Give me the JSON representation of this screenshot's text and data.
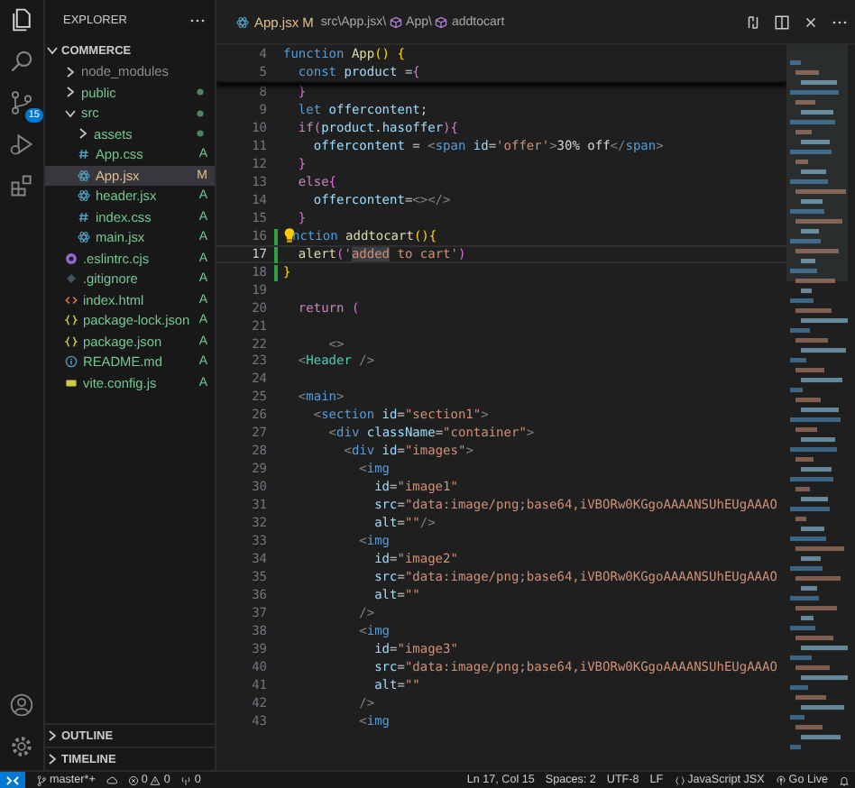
{
  "activity_bar": {
    "source_control_badge": "15"
  },
  "sidebar": {
    "title": "EXPLORER",
    "workspace": {
      "label": "COMMERCE",
      "expanded": true
    },
    "tree": [
      {
        "kind": "folder",
        "name": "node_modules",
        "expanded": false,
        "dot": false,
        "selected": false,
        "color": "#8c8c8c"
      },
      {
        "kind": "folder",
        "name": "public",
        "expanded": false,
        "dot": true,
        "selected": false,
        "color": "#73c991"
      },
      {
        "kind": "folder",
        "name": "src",
        "expanded": true,
        "dot": true,
        "selected": false,
        "color": "#73c991",
        "children": [
          {
            "kind": "folder",
            "name": "assets",
            "expanded": false,
            "dot": true,
            "selected": false,
            "color": "#73c991"
          },
          {
            "kind": "css",
            "name": "App.css",
            "status": "A",
            "selected": false,
            "color": "#73c991"
          },
          {
            "kind": "react",
            "name": "App.jsx",
            "status": "M",
            "selected": true,
            "color": "#e2c08d"
          },
          {
            "kind": "react",
            "name": "header.jsx",
            "status": "A",
            "selected": false,
            "color": "#73c991"
          },
          {
            "kind": "css",
            "name": "index.css",
            "status": "A",
            "selected": false,
            "color": "#73c991"
          },
          {
            "kind": "react",
            "name": "main.jsx",
            "status": "A",
            "selected": false,
            "color": "#73c991"
          }
        ]
      },
      {
        "kind": "eslint",
        "name": ".eslintrc.cjs",
        "status": "A",
        "selected": false,
        "color": "#73c991"
      },
      {
        "kind": "git",
        "name": ".gitignore",
        "status": "A",
        "selected": false,
        "color": "#73c991"
      },
      {
        "kind": "html",
        "name": "index.html",
        "status": "A",
        "selected": false,
        "color": "#73c991"
      },
      {
        "kind": "json",
        "name": "package-lock.json",
        "status": "A",
        "selected": false,
        "color": "#73c991"
      },
      {
        "kind": "json",
        "name": "package.json",
        "status": "A",
        "selected": false,
        "color": "#73c991"
      },
      {
        "kind": "info",
        "name": "README.md",
        "status": "A",
        "selected": false,
        "color": "#73c991"
      },
      {
        "kind": "js",
        "name": "vite.config.js",
        "status": "A",
        "selected": false,
        "color": "#73c991"
      }
    ],
    "panels": [
      {
        "label": "OUTLINE",
        "expanded": false
      },
      {
        "label": "TIMELINE",
        "expanded": false
      }
    ]
  },
  "editor": {
    "tab": {
      "label": "App.jsx",
      "status": "M"
    },
    "breadcrumbs": [
      {
        "kind": "path",
        "label": "src\\App.jsx\\"
      },
      {
        "kind": "symbol",
        "label": "App\\"
      },
      {
        "kind": "symbol",
        "label": "addtocart"
      }
    ],
    "sticky_lines": [
      {
        "n": "4",
        "tokens": [
          {
            "text": "function ",
            "kind": "kw"
          },
          {
            "text": "App",
            "kind": "fn"
          },
          {
            "text": "() {",
            "kind": "b1"
          }
        ]
      },
      {
        "n": "5",
        "tokens": [
          {
            "text": "  const ",
            "kind": "kw"
          },
          {
            "text": "product",
            "kind": "var"
          },
          {
            "text": " =",
            "kind": "p"
          },
          {
            "text": "{",
            "kind": "b2"
          }
        ]
      }
    ],
    "lines": [
      {
        "n": "8",
        "current": false,
        "added": false,
        "tokens": [
          {
            "text": "  }",
            "kind": "b2"
          }
        ]
      },
      {
        "n": "9",
        "current": false,
        "added": false,
        "tokens": [
          {
            "text": "  let ",
            "kind": "kw"
          },
          {
            "text": "offercontent",
            "kind": "var"
          },
          {
            "text": ";",
            "kind": "p"
          }
        ]
      },
      {
        "n": "10",
        "current": false,
        "added": false,
        "tokens": [
          {
            "text": "  if",
            "kind": "ctl"
          },
          {
            "text": "(",
            "kind": "b2"
          },
          {
            "text": "product",
            "kind": "var"
          },
          {
            "text": ".",
            "kind": "p"
          },
          {
            "text": "hasoffer",
            "kind": "var"
          },
          {
            "text": "){",
            "kind": "b2"
          }
        ]
      },
      {
        "n": "11",
        "current": false,
        "added": false,
        "tokens": [
          {
            "text": "    offercontent",
            "kind": "var"
          },
          {
            "text": " = ",
            "kind": "p"
          },
          {
            "text": "<",
            "kind": "tag-b"
          },
          {
            "text": "span",
            "kind": "tag"
          },
          {
            "text": " id",
            "kind": "attr"
          },
          {
            "text": "=",
            "kind": "p"
          },
          {
            "text": "'offer'",
            "kind": "str"
          },
          {
            "text": ">",
            "kind": "tag-b"
          },
          {
            "text": "30% off",
            "kind": "p"
          },
          {
            "text": "</",
            "kind": "tag-b"
          },
          {
            "text": "span",
            "kind": "tag"
          },
          {
            "text": ">",
            "kind": "tag-b"
          }
        ]
      },
      {
        "n": "12",
        "current": false,
        "added": false,
        "tokens": [
          {
            "text": "  }",
            "kind": "b2"
          }
        ]
      },
      {
        "n": "13",
        "current": false,
        "added": false,
        "tokens": [
          {
            "text": "  else",
            "kind": "ctl"
          },
          {
            "text": "{",
            "kind": "b2"
          }
        ]
      },
      {
        "n": "14",
        "current": false,
        "added": false,
        "tokens": [
          {
            "text": "    offercontent",
            "kind": "var"
          },
          {
            "text": "=",
            "kind": "p"
          },
          {
            "text": "<></>",
            "kind": "tag-b"
          }
        ]
      },
      {
        "n": "15",
        "current": false,
        "added": false,
        "tokens": [
          {
            "text": "  }",
            "kind": "b2"
          }
        ]
      },
      {
        "n": "16",
        "current": false,
        "added": true,
        "tokens": [
          {
            "kind": "bulb"
          },
          {
            "text": "nction ",
            "kind": "kw"
          },
          {
            "text": "addtocart",
            "kind": "fn"
          },
          {
            "text": "(){",
            "kind": "b1"
          }
        ]
      },
      {
        "n": "17",
        "current": true,
        "added": true,
        "tokens": [
          {
            "text": "  alert",
            "kind": "fn"
          },
          {
            "text": "(",
            "kind": "b2"
          },
          {
            "text": "'",
            "kind": "str"
          },
          {
            "text": "added",
            "kind": "str-hl"
          },
          {
            "text": " to cart'",
            "kind": "str"
          },
          {
            "text": ")",
            "kind": "b2"
          }
        ]
      },
      {
        "n": "18",
        "current": false,
        "added": true,
        "tokens": [
          {
            "text": "}",
            "kind": "b1"
          }
        ]
      },
      {
        "n": "19",
        "current": false,
        "added": false
      },
      {
        "n": "20",
        "current": false,
        "added": false,
        "tokens": [
          {
            "text": "  return ",
            "kind": "ctl"
          },
          {
            "text": "(",
            "kind": "b2"
          }
        ]
      },
      {
        "n": "21",
        "current": false,
        "added": false
      },
      {
        "n": "22",
        "current": false,
        "added": false,
        "tokens": [
          {
            "text": "      <>",
            "kind": "tag-b"
          }
        ]
      },
      {
        "n": "23",
        "current": false,
        "added": false,
        "tokens": [
          {
            "text": "  <",
            "kind": "tag-b"
          },
          {
            "text": "Header",
            "kind": "comp"
          },
          {
            "text": " />",
            "kind": "tag-b"
          }
        ]
      },
      {
        "n": "24",
        "current": false,
        "added": false
      },
      {
        "n": "25",
        "current": false,
        "added": false,
        "tokens": [
          {
            "text": "  <",
            "kind": "tag-b"
          },
          {
            "text": "main",
            "kind": "tag"
          },
          {
            "text": ">",
            "kind": "tag-b"
          }
        ]
      },
      {
        "n": "26",
        "current": false,
        "added": false,
        "tokens": [
          {
            "text": "    <",
            "kind": "tag-b"
          },
          {
            "text": "section",
            "kind": "tag"
          },
          {
            "text": " id",
            "kind": "attr"
          },
          {
            "text": "=",
            "kind": "p"
          },
          {
            "text": "\"section1\"",
            "kind": "str"
          },
          {
            "text": ">",
            "kind": "tag-b"
          }
        ]
      },
      {
        "n": "27",
        "current": false,
        "added": false,
        "tokens": [
          {
            "text": "      <",
            "kind": "tag-b"
          },
          {
            "text": "div",
            "kind": "tag"
          },
          {
            "text": " className",
            "kind": "attr"
          },
          {
            "text": "=",
            "kind": "p"
          },
          {
            "text": "\"container\"",
            "kind": "str"
          },
          {
            "text": ">",
            "kind": "tag-b"
          }
        ]
      },
      {
        "n": "28",
        "current": false,
        "added": false,
        "tokens": [
          {
            "text": "        <",
            "kind": "tag-b"
          },
          {
            "text": "div",
            "kind": "tag"
          },
          {
            "text": " id",
            "kind": "attr"
          },
          {
            "text": "=",
            "kind": "p"
          },
          {
            "text": "\"images\"",
            "kind": "str"
          },
          {
            "text": ">",
            "kind": "tag-b"
          }
        ]
      },
      {
        "n": "29",
        "current": false,
        "added": false,
        "tokens": [
          {
            "text": "          <",
            "kind": "tag-b"
          },
          {
            "text": "img",
            "kind": "tag"
          }
        ]
      },
      {
        "n": "30",
        "current": false,
        "added": false,
        "tokens": [
          {
            "text": "            id",
            "kind": "attr"
          },
          {
            "text": "=",
            "kind": "p"
          },
          {
            "text": "\"image1\"",
            "kind": "str"
          }
        ]
      },
      {
        "n": "31",
        "current": false,
        "added": false,
        "tokens": [
          {
            "text": "            src",
            "kind": "attr"
          },
          {
            "text": "=",
            "kind": "p"
          },
          {
            "text": "\"data:image/png;base64,iVBORw0KGgoAAAANSUhEUgAAAO",
            "kind": "str"
          }
        ]
      },
      {
        "n": "32",
        "current": false,
        "added": false,
        "tokens": [
          {
            "text": "            alt",
            "kind": "attr"
          },
          {
            "text": "=",
            "kind": "p"
          },
          {
            "text": "\"\"",
            "kind": "str"
          },
          {
            "text": "/>",
            "kind": "tag-b"
          }
        ]
      },
      {
        "n": "33",
        "current": false,
        "added": false,
        "tokens": [
          {
            "text": "          <",
            "kind": "tag-b"
          },
          {
            "text": "img",
            "kind": "tag"
          }
        ]
      },
      {
        "n": "34",
        "current": false,
        "added": false,
        "tokens": [
          {
            "text": "            id",
            "kind": "attr"
          },
          {
            "text": "=",
            "kind": "p"
          },
          {
            "text": "\"image2\"",
            "kind": "str"
          }
        ]
      },
      {
        "n": "35",
        "current": false,
        "added": false,
        "tokens": [
          {
            "text": "            src",
            "kind": "attr"
          },
          {
            "text": "=",
            "kind": "p"
          },
          {
            "text": "\"data:image/png;base64,iVBORw0KGgoAAAANSUhEUgAAAO",
            "kind": "str"
          }
        ]
      },
      {
        "n": "36",
        "current": false,
        "added": false,
        "tokens": [
          {
            "text": "            alt",
            "kind": "attr"
          },
          {
            "text": "=",
            "kind": "p"
          },
          {
            "text": "\"\"",
            "kind": "str"
          }
        ]
      },
      {
        "n": "37",
        "current": false,
        "added": false,
        "tokens": [
          {
            "text": "          />",
            "kind": "tag-b"
          }
        ]
      },
      {
        "n": "38",
        "current": false,
        "added": false,
        "tokens": [
          {
            "text": "          <",
            "kind": "tag-b"
          },
          {
            "text": "img",
            "kind": "tag"
          }
        ]
      },
      {
        "n": "39",
        "current": false,
        "added": false,
        "tokens": [
          {
            "text": "            id",
            "kind": "attr"
          },
          {
            "text": "=",
            "kind": "p"
          },
          {
            "text": "\"image3\"",
            "kind": "str"
          }
        ]
      },
      {
        "n": "40",
        "current": false,
        "added": false,
        "tokens": [
          {
            "text": "            src",
            "kind": "attr"
          },
          {
            "text": "=",
            "kind": "p"
          },
          {
            "text": "\"data:image/png;base64,iVBORw0KGgoAAAANSUhEUgAAAO",
            "kind": "str"
          }
        ]
      },
      {
        "n": "41",
        "current": false,
        "added": false,
        "tokens": [
          {
            "text": "            alt",
            "kind": "attr"
          },
          {
            "text": "=",
            "kind": "p"
          },
          {
            "text": "\"\"",
            "kind": "str"
          }
        ]
      },
      {
        "n": "42",
        "current": false,
        "added": false,
        "tokens": [
          {
            "text": "          />",
            "kind": "tag-b"
          }
        ]
      },
      {
        "n": "43",
        "current": false,
        "added": false,
        "tokens": [
          {
            "text": "          <",
            "kind": "tag-b"
          },
          {
            "text": "img",
            "kind": "tag"
          }
        ]
      }
    ]
  },
  "status_bar": {
    "branch": "master*+",
    "errors": "0",
    "warnings": "0",
    "ports": "0",
    "position": "Ln 17, Col 15",
    "indentation": "Spaces: 2",
    "encoding": "UTF-8",
    "eol": "LF",
    "language": "JavaScript JSX",
    "live_server": "Go Live"
  }
}
